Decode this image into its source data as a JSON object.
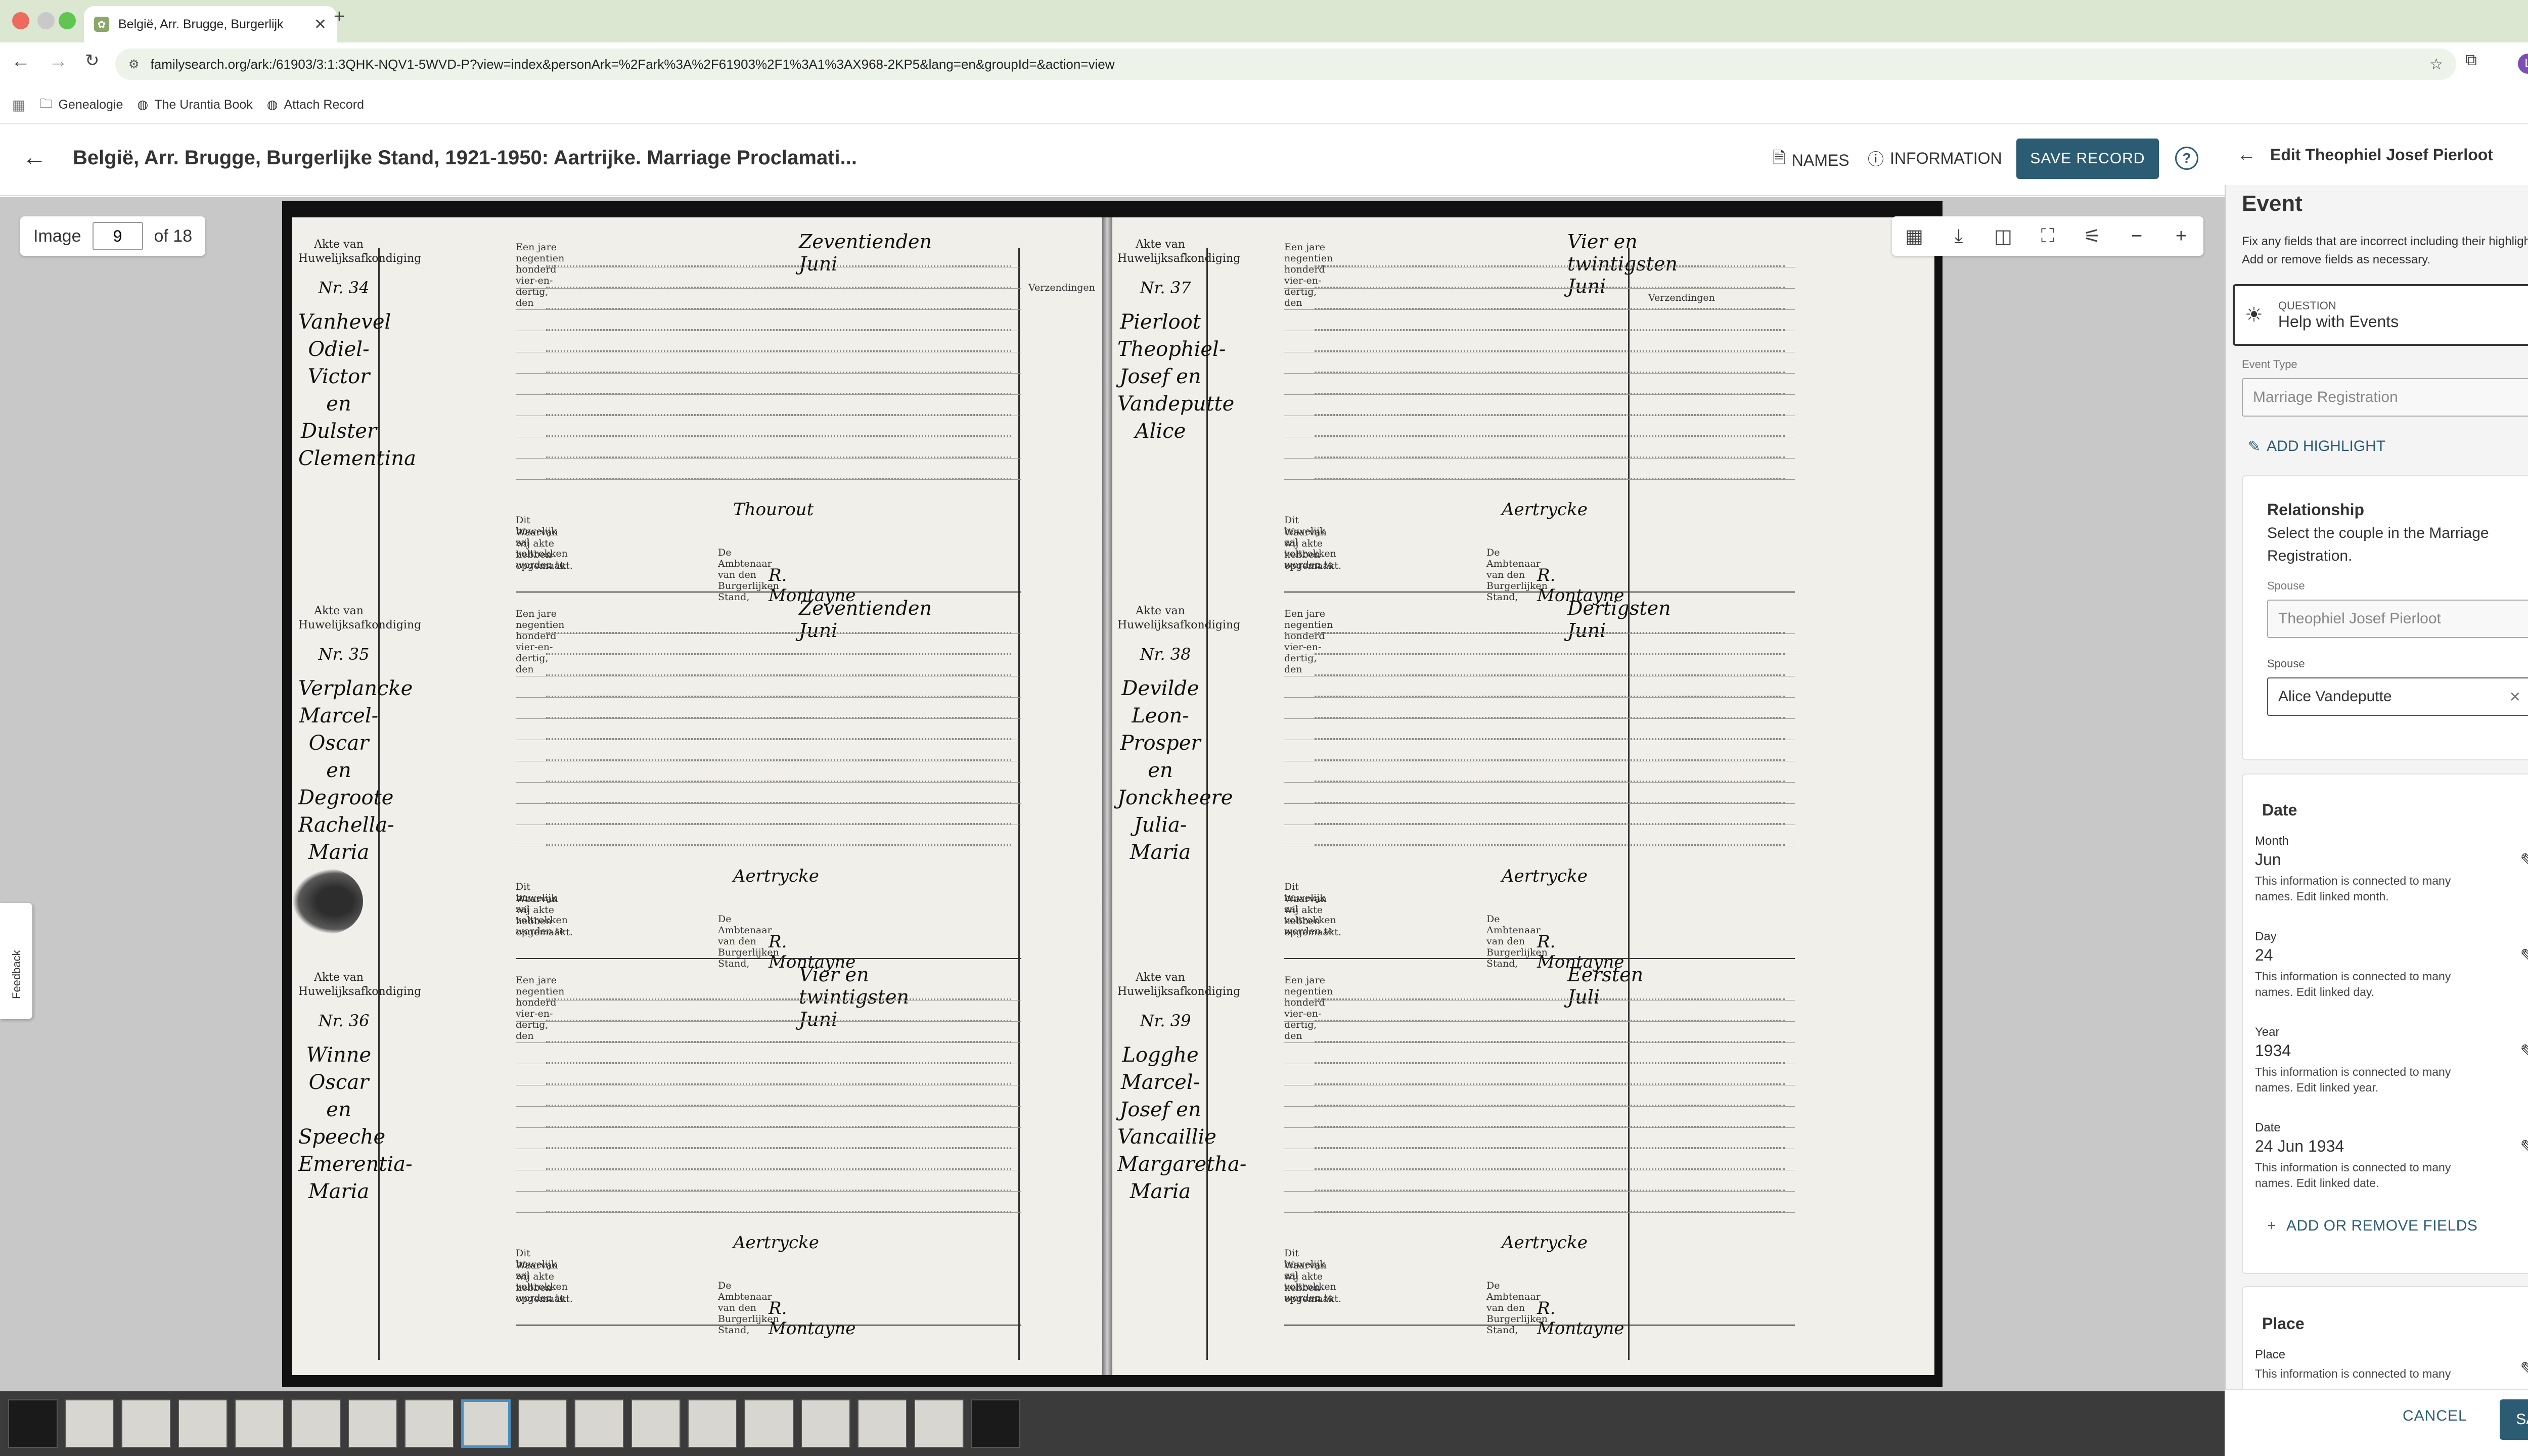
{
  "browser": {
    "tab_title": "België, Arr. Brugge, Burgerlijk",
    "url": "familysearch.org/ark:/61903/3:1:3QHK-NQV1-5WVD-P?view=index&personArk=%2Fark%3A%2F61903%2F1%3A1%3AX968-2KP5&lang=en&groupId=&action=view",
    "bookmarks": [
      "Genealogie",
      "The Urantia Book",
      "Attach Record"
    ],
    "profile_initial": "L"
  },
  "header": {
    "title": "België, Arr. Brugge, Burgerlijke Stand, 1921-1950: Aartrijke. Marriage Proclamati...",
    "names_label": "NAMES",
    "information_label": "INFORMATION",
    "save_record_label": "SAVE RECORD"
  },
  "viewer": {
    "image_label": "Image",
    "image_number": "9",
    "image_total": "of 18",
    "feedback_label": "Feedback"
  },
  "document": {
    "left_entries": [
      {
        "akte": "Akte van Huwelijksafkondiging",
        "nr": "Nr. 34",
        "names": "Vanhevel Odiel-Victor en Dulster Clementina",
        "date": "Zeventienden Juni",
        "place": "Thourout"
      },
      {
        "akte": "Akte van Huwelijksafkondiging",
        "nr": "Nr. 35",
        "names": "Verplancke Marcel-Oscar en Degroote Rachella-Maria",
        "date": "Zeventienden Juni",
        "place": "Aertrycke"
      },
      {
        "akte": "Akte van Huwelijksafkondiging",
        "nr": "Nr. 36",
        "names": "Winne Oscar en Speeche Emerentia-Maria",
        "date": "Vier en twintigsten Juni",
        "place": "Aertrycke"
      }
    ],
    "right_entries": [
      {
        "akte": "Akte van Huwelijksafkondiging",
        "nr": "Nr. 37",
        "names": "Pierloot Theophiel-Josef en Vandeputte Alice",
        "date": "Vier en twintigsten Juni",
        "place": "Aertrycke"
      },
      {
        "akte": "Akte van Huwelijksafkondiging",
        "nr": "Nr. 38",
        "names": "Devilde Leon-Prosper en Jonckheere Julia-Maria",
        "date": "Dertigsten Juni",
        "place": "Aertrycke"
      },
      {
        "akte": "Akte van Huwelijksafkondiging",
        "nr": "Nr. 39",
        "names": "Logghe Marcel-Josef en Vancaillie Margaretha-Maria",
        "date": "Eersten Juli",
        "place": "Aertrycke"
      }
    ],
    "preamble": "Een jare negentien honderd vier-en-dertig, den",
    "footer_1": "Dit huwelijk zal voltrokken worden te",
    "footer_2": "Waarvan wij akte hebben opgemaakt.",
    "ambtenaar": "De Ambtenaar van den Burgerlijken Stand,",
    "verzendingen": "Verzendingen"
  },
  "panel": {
    "title": "Edit Theophiel Josef Pierloot",
    "section": "Event",
    "instructions": "Fix any fields that are incorrect including their highlights. Add or remove fields as necessary.",
    "question_label": "QUESTION",
    "question_value": "Help with Events",
    "event_type_label": "Event Type",
    "event_type_value": "Marriage Registration",
    "add_highlight": "ADD HIGHLIGHT",
    "relationship": {
      "title": "Relationship",
      "desc": "Select the couple in the Marriage Registration.",
      "spouse_label": "Spouse",
      "spouse1": "Theophiel Josef Pierloot",
      "spouse2": "Alice Vandeputte"
    },
    "date": {
      "title": "Date",
      "fields": [
        {
          "label": "Month",
          "value": "Jun",
          "note": "This information is connected to many names. Edit linked month."
        },
        {
          "label": "Day",
          "value": "24",
          "note": "This information is connected to many names. Edit linked day."
        },
        {
          "label": "Year",
          "value": "1934",
          "note": "This information is connected to many names. Edit linked year."
        },
        {
          "label": "Date",
          "value": "24 Jun 1934",
          "note": "This information is connected to many names. Edit linked date."
        }
      ],
      "add_remove": "ADD OR REMOVE FIELDS"
    },
    "place": {
      "title": "Place",
      "label": "Place",
      "note": "This information is connected to many"
    },
    "cancel": "CANCEL",
    "save": "SAVE"
  }
}
